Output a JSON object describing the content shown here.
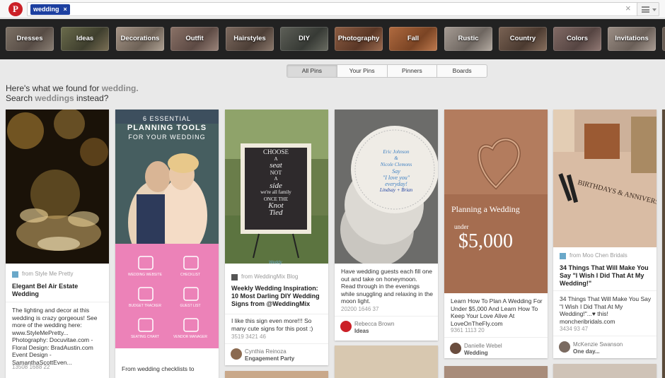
{
  "search": {
    "token": "wedding",
    "token_close": "×",
    "clear": "×"
  },
  "categories": [
    "Dresses",
    "Ideas",
    "Decorations",
    "Outfit",
    "Hairstyles",
    "DIY",
    "Photography",
    "Fall",
    "Rustic",
    "Country",
    "Colors",
    "Invitations"
  ],
  "tabs": [
    "All Pins",
    "Your Pins",
    "Pinners",
    "Boards"
  ],
  "found": {
    "line1_prefix": "Here's what we found for ",
    "term": "wedding.",
    "line2_prefix": "Search ",
    "alt": "weddings",
    "line2_suffix": " instead?"
  },
  "pins": [
    {
      "source": "from Style Me Pretty",
      "title": "Elegant Bel Air Estate Wedding",
      "desc": "The lighting and decor at this wedding is crazy gorgeous! See more of the wedding here: www.StyleMePretty... Photography: Docuvitae.com - Floral Design: BradAustin.com Event Design - SamanthaScottEven...",
      "stats": "13508   1688   22"
    },
    {
      "img_line1": "6 ESSENTIAL",
      "img_line2": "PLANNING TOOLS",
      "img_line3": "FOR YOUR WEDDING",
      "tools": [
        "WEDDING WEBSITE",
        "CHECKLIST",
        "BUDGET TRACKER",
        "GUEST LIST",
        "SEATING CHART",
        "VENDOR MANAGER"
      ],
      "desc": "From wedding checklists to"
    },
    {
      "sign": [
        "CHOOSE",
        "A",
        "seat",
        "NOT",
        "A",
        "side",
        "we're all family",
        "ONCE THE",
        "Knot",
        "Tied"
      ],
      "watermark": "Weddy",
      "source": "from WeddingMix Blog",
      "title": "Weekly Wedding Inspiration: 10 Most Darling DIY Wedding Signs from @WeddingMix",
      "desc": "I like this sign even more!!! So many cute signs for this post :)",
      "stats": "3519   3421   46",
      "user": "Cynthia Reinoza",
      "board": "Engagement Party"
    },
    {
      "coaster": [
        "Eric Johnson",
        "&",
        "Nicole Clemons",
        "Say",
        "\"I love you\"",
        "everyday!",
        "Lindsay + Brian"
      ],
      "desc": "Have wedding guests each fill one out and take on honeymoon. Read through in the evenings while snuggling and relaxing in the moon light.",
      "stats": "20200   1646   37",
      "user": "Rebecca Brown",
      "board": "Ideas"
    },
    {
      "img_line1": "Planning a Wedding",
      "img_line2": "under",
      "img_line3": "$5,000",
      "desc": "Learn How To Plan A Wedding For Under $5,000 And Learn How To Keep Your Love Alive At LoveOnTheFly.com",
      "stats": "9361   1113   20",
      "user": "Danielle Webel",
      "board": "Wedding"
    },
    {
      "img_text": "BIRTHDAYS & ANNIVERS",
      "source": "from Moo Chen Bridals",
      "title": "34 Things That Will Make You Say \"I Wish I Did That At My Wedding!\"",
      "desc": "34 Things That Will Make You Say \"I Wish I Did That At My Wedding!\"...♥ this! moncheribridals.com",
      "stats": "3434   93   47",
      "user": "McKenzie Swanson",
      "board": "One day..."
    }
  ],
  "colors": {
    "accent": "#cb2027",
    "token": "#1c3fa0",
    "pink": "#ec82b8"
  }
}
